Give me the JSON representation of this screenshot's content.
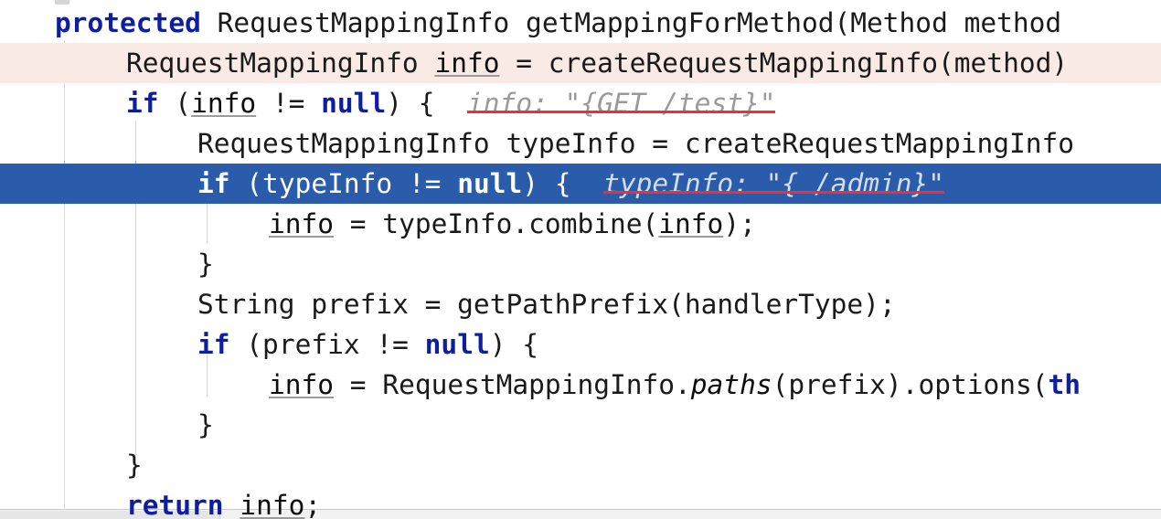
{
  "editor": {
    "language": "java",
    "theme": "light",
    "colors": {
      "keyword": "#0d1fa0",
      "text": "#1a1a1a",
      "selected_line_bg": "#2a5cab",
      "selected_line_fg": "#ffffff",
      "executing_line_bg": "#faeae5",
      "inline_hint_fg": "#9a9a9a",
      "annotation_underline": "#f03030",
      "indent_guide": "#d5d5d5",
      "background": "#ffffff"
    },
    "lines": [
      {
        "id": "line-1",
        "indent": 1,
        "highlight": "none",
        "tokens": [
          {
            "t": "protected ",
            "k": "kw"
          },
          {
            "t": "RequestMappingInfo getMappingForMethod(Method method",
            "k": "plain"
          }
        ],
        "text": "protected RequestMappingInfo getMappingForMethod(Method method"
      },
      {
        "id": "line-2",
        "indent": 2,
        "highlight": "pink",
        "tokens": [
          {
            "t": "RequestMappingInfo ",
            "k": "plain"
          },
          {
            "t": "info",
            "k": "fld"
          },
          {
            "t": " = createRequestMappingInfo(method)",
            "k": "plain"
          }
        ],
        "text": "RequestMappingInfo info = createRequestMappingInfo(method)"
      },
      {
        "id": "line-3",
        "indent": 2,
        "highlight": "none",
        "tokens": [
          {
            "t": "if",
            "k": "kw"
          },
          {
            "t": " (",
            "k": "plain"
          },
          {
            "t": "info",
            "k": "fld"
          },
          {
            "t": " != ",
            "k": "plain"
          },
          {
            "t": "null",
            "k": "kw"
          },
          {
            "t": ") {",
            "k": "plain"
          }
        ],
        "text": "if (info != null) {",
        "hint": "info: \"{GET /test}\""
      },
      {
        "id": "line-4",
        "indent": 3,
        "highlight": "none",
        "tokens": [
          {
            "t": "RequestMappingInfo typeInfo = createRequestMappingInfo",
            "k": "plain"
          }
        ],
        "text": "RequestMappingInfo typeInfo = createRequestMappingInfo"
      },
      {
        "id": "line-5",
        "indent": 3,
        "highlight": "selected",
        "tokens": [
          {
            "t": "if",
            "k": "kw"
          },
          {
            "t": " (typeInfo != ",
            "k": "plain"
          },
          {
            "t": "null",
            "k": "kw"
          },
          {
            "t": ") {",
            "k": "plain"
          }
        ],
        "text": "if (typeInfo != null) {",
        "hint": "typeInfo: \"{ /admin}\""
      },
      {
        "id": "line-6",
        "indent": 4,
        "highlight": "none",
        "tokens": [
          {
            "t": "info",
            "k": "fld"
          },
          {
            "t": " = typeInfo.combine(",
            "k": "plain"
          },
          {
            "t": "info",
            "k": "fld"
          },
          {
            "t": ");",
            "k": "plain"
          }
        ],
        "text": "info = typeInfo.combine(info);"
      },
      {
        "id": "line-7",
        "indent": 3,
        "highlight": "none",
        "tokens": [
          {
            "t": "}",
            "k": "plain"
          }
        ],
        "text": "}"
      },
      {
        "id": "line-8",
        "indent": 3,
        "highlight": "none",
        "tokens": [
          {
            "t": "String prefix = getPathPrefix(handlerType);",
            "k": "plain"
          }
        ],
        "text": "String prefix = getPathPrefix(handlerType);"
      },
      {
        "id": "line-9",
        "indent": 3,
        "highlight": "none",
        "tokens": [
          {
            "t": "if",
            "k": "kw"
          },
          {
            "t": " (prefix != ",
            "k": "plain"
          },
          {
            "t": "null",
            "k": "kw"
          },
          {
            "t": ") {",
            "k": "plain"
          }
        ],
        "text": "if (prefix != null) {"
      },
      {
        "id": "line-10",
        "indent": 4,
        "highlight": "none",
        "tokens": [
          {
            "t": "info",
            "k": "fld"
          },
          {
            "t": " = RequestMappingInfo.",
            "k": "plain"
          },
          {
            "t": "paths",
            "k": "stat"
          },
          {
            "t": "(prefix).options(",
            "k": "plain"
          },
          {
            "t": "th",
            "k": "kw"
          }
        ],
        "text": "info = RequestMappingInfo.paths(prefix).options(th"
      },
      {
        "id": "line-11",
        "indent": 3,
        "highlight": "none",
        "tokens": [
          {
            "t": "}",
            "k": "plain"
          }
        ],
        "text": "}"
      },
      {
        "id": "line-12",
        "indent": 2,
        "highlight": "none",
        "tokens": [
          {
            "t": "}",
            "k": "plain"
          }
        ],
        "text": "}"
      },
      {
        "id": "line-13",
        "indent": 2,
        "highlight": "none",
        "tokens": [
          {
            "t": "return",
            "k": "kw"
          },
          {
            "t": " ",
            "k": "plain"
          },
          {
            "t": "info",
            "k": "fld"
          },
          {
            "t": ";",
            "k": "plain"
          }
        ],
        "text": "return info;"
      }
    ]
  }
}
